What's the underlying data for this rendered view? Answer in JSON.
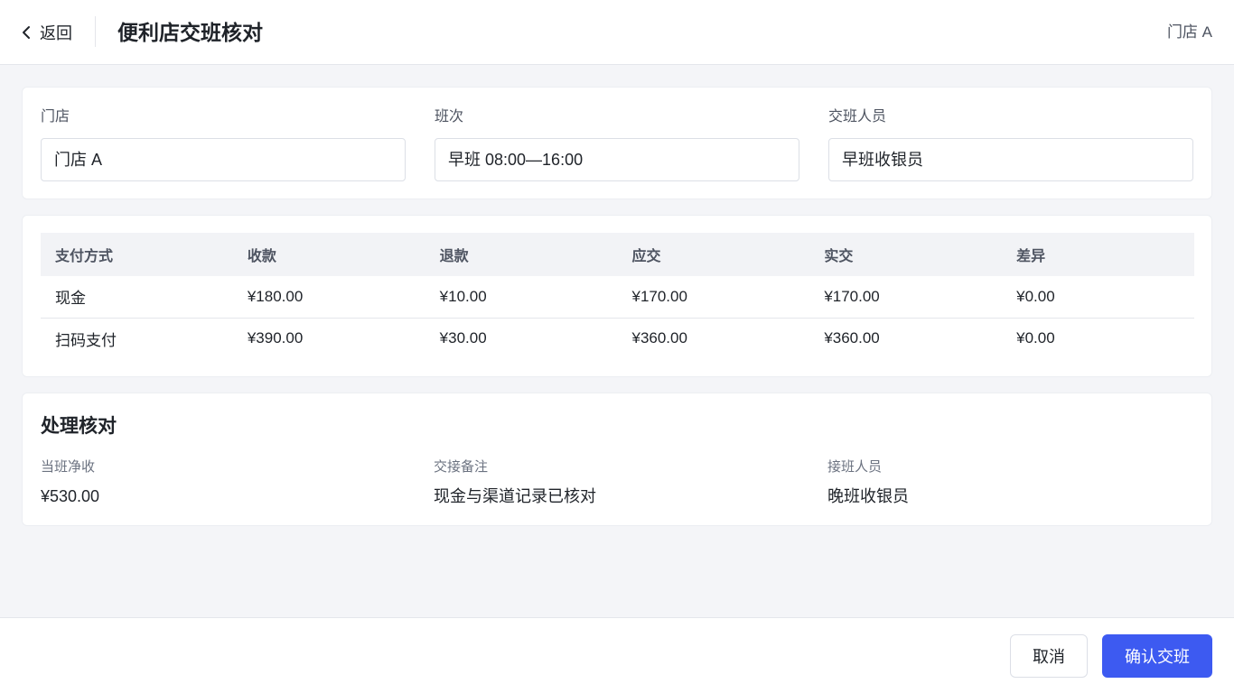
{
  "header": {
    "back_label": "返回",
    "title": "便利店交班核对",
    "store": "门店 A"
  },
  "info": {
    "fields": [
      {
        "label": "门店",
        "value": "门店 A"
      },
      {
        "label": "班次",
        "value": "早班 08:00—16:00"
      },
      {
        "label": "交班人员",
        "value": "早班收银员"
      }
    ]
  },
  "table": {
    "columns": [
      "支付方式",
      "收款",
      "退款",
      "应交",
      "实交",
      "差异"
    ],
    "rows": [
      [
        "现金",
        "¥180.00",
        "¥10.00",
        "¥170.00",
        "¥170.00",
        "¥0.00"
      ],
      [
        "扫码支付",
        "¥390.00",
        "¥30.00",
        "¥360.00",
        "¥360.00",
        "¥0.00"
      ]
    ]
  },
  "process": {
    "title": "处理核对",
    "items": [
      {
        "label": "当班净收",
        "value": "¥530.00"
      },
      {
        "label": "交接备注",
        "value": "现金与渠道记录已核对"
      },
      {
        "label": "接班人员",
        "value": "晚班收银员"
      }
    ]
  },
  "footer": {
    "cancel_label": "取消",
    "confirm_label": "确认交班"
  },
  "colors": {
    "accent": "#3d5af1",
    "page_bg": "#f4f5f8",
    "table_header_bg": "#f2f3f6"
  },
  "icons": {
    "back": "chevron-left-icon"
  }
}
